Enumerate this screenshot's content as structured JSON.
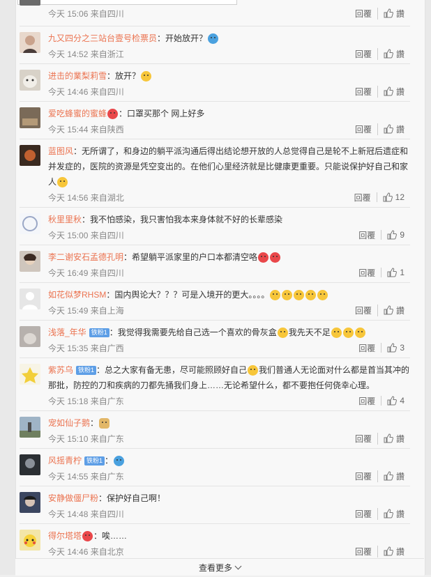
{
  "common": {
    "reply": "回覆",
    "like": "讚"
  },
  "more_label": "查看更多",
  "comments": [
    {
      "user": "",
      "text": "",
      "time": "今天 15:06 来自四川",
      "likes": ""
    },
    {
      "user": "九又四分之三站台壹号检票员",
      "text": "：开始放开？",
      "time": "今天 14:52 来自浙江",
      "likes": ""
    },
    {
      "user": "进击的業梨莉雪",
      "text": "：放开？",
      "time": "今天 14:46 来自四川",
      "likes": ""
    },
    {
      "user": "爱吃蜂蜜的蜜蜂",
      "text": "：口罩买那个 网上好多",
      "time": "今天 15:44 来自陕西",
      "likes": ""
    },
    {
      "user": "蓝图风",
      "text": "：无所谓了，和身边的躺平派沟通后得出结论想开放的人总觉得自己是轮不上新冠后遗症和并发症的，医院的资源是凭空变出的。在他们心里经济就是比健康更重要。只能说保护好自己和家人",
      "time": "今天 14:56 来自湖北",
      "likes": "12"
    },
    {
      "user": "秋里里秋",
      "text": "：我不怕感染，我只害怕我本来身体就不好的长辈感染",
      "time": "今天 15:00 来自四川",
      "likes": "9"
    },
    {
      "user": "李二谢安石孟德孔明",
      "text": "：希望躺平派家里的户口本都清空咯",
      "time": "今天 16:49 来自四川",
      "likes": "1"
    },
    {
      "user": "如花似梦RHSM",
      "text": "：国内舆论大？？？可是入境开的更大。。。。",
      "time": "今天 15:49 来自上海",
      "likes": ""
    },
    {
      "user": "浅落_年华",
      "badge": "铁粉1",
      "text": "：我觉得我需要先给自己选一个喜欢的骨灰盒",
      "text2": "我先天不足",
      "time": "今天 15:35 来自广西",
      "likes": "3"
    },
    {
      "user": "紫苏乌",
      "badge": "铁粉1",
      "text": "：总之大家有备无患，尽可能照顾好自己",
      "text2": "我们普通人无论面对什么都是首当其冲的那批，防控的刀和疾病的刀都先捅我们身上……无论希望什么，都不要抱任何侥幸心理。",
      "time": "今天 15:18 来自广东",
      "likes": "4"
    },
    {
      "user": "宠如仙子鹅",
      "text": "：",
      "time": "今天 15:10 来自广东",
      "likes": ""
    },
    {
      "user": "风摇青柠",
      "badge": "铁粉1",
      "text": "：",
      "time": "今天 14:55 来自广东",
      "likes": ""
    },
    {
      "user": "安静做僵尸粉",
      "text": "：保护好自己啊！",
      "time": "今天 14:48 来自四川",
      "likes": ""
    },
    {
      "user": "得尔塔塔",
      "text": "：唉……",
      "time": "今天 14:46 来自北京",
      "likes": ""
    }
  ],
  "colors": {
    "username": "#eb7350",
    "meta": "#888888",
    "badge": "#5d9ee6"
  }
}
